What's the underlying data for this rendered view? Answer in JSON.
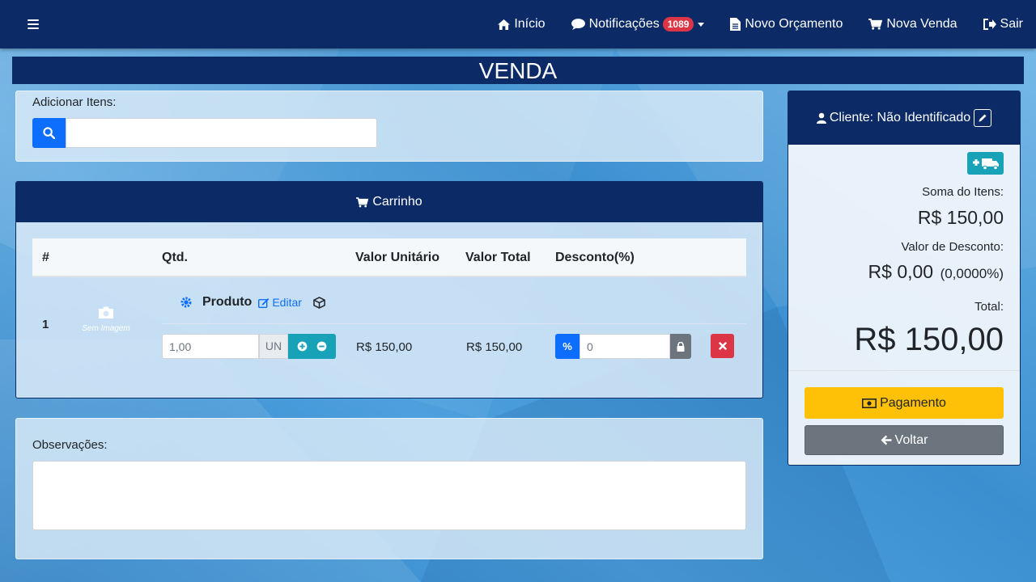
{
  "navbar": {
    "menu_icon": "bars-icon",
    "items": [
      {
        "label": "Início",
        "icon": "home-icon"
      },
      {
        "label": "Notificações",
        "icon": "comment-icon",
        "badge": "1089"
      },
      {
        "label": "Novo Orçamento",
        "icon": "file-icon"
      },
      {
        "label": "Nova Venda",
        "icon": "cart-icon"
      },
      {
        "label": "Sair",
        "icon": "sign-out-icon"
      }
    ]
  },
  "page": {
    "title": "VENDA"
  },
  "add_items": {
    "label": "Adicionar Itens:",
    "search_value": "",
    "search_icon": "search-icon"
  },
  "cart": {
    "title": "Carrinho",
    "columns": [
      "#",
      "Qtd.",
      "Valor Unitário",
      "Valor Total",
      "Desconto(%)"
    ],
    "rows": [
      {
        "index": "1",
        "image_text": "Sem Imagem",
        "product_name": "Produto",
        "edit_label": "Editar",
        "quantity": "1,00",
        "unit": "UN",
        "unit_price": "R$ 150,00",
        "total_price": "R$ 150,00",
        "discount_symbol": "%",
        "discount_value": "0"
      }
    ]
  },
  "observations": {
    "label": "Observações:",
    "value": ""
  },
  "summary": {
    "client_label": "Cliente: Não Identificado",
    "items_sum_label": "Soma do Itens:",
    "items_sum_value": "R$ 150,00",
    "discount_label": "Valor de Desconto:",
    "discount_value": "R$ 0,00",
    "discount_percent": "(0,0000%)",
    "total_label": "Total:",
    "total_value": "R$ 150,00",
    "pay_button": "Pagamento",
    "back_button": "Voltar"
  },
  "colors": {
    "navy": "#0b2a66",
    "primary": "#0d6efd",
    "info": "#17a2b8",
    "danger": "#dc3545",
    "warning": "#ffc107",
    "secondary": "#6c757d"
  }
}
